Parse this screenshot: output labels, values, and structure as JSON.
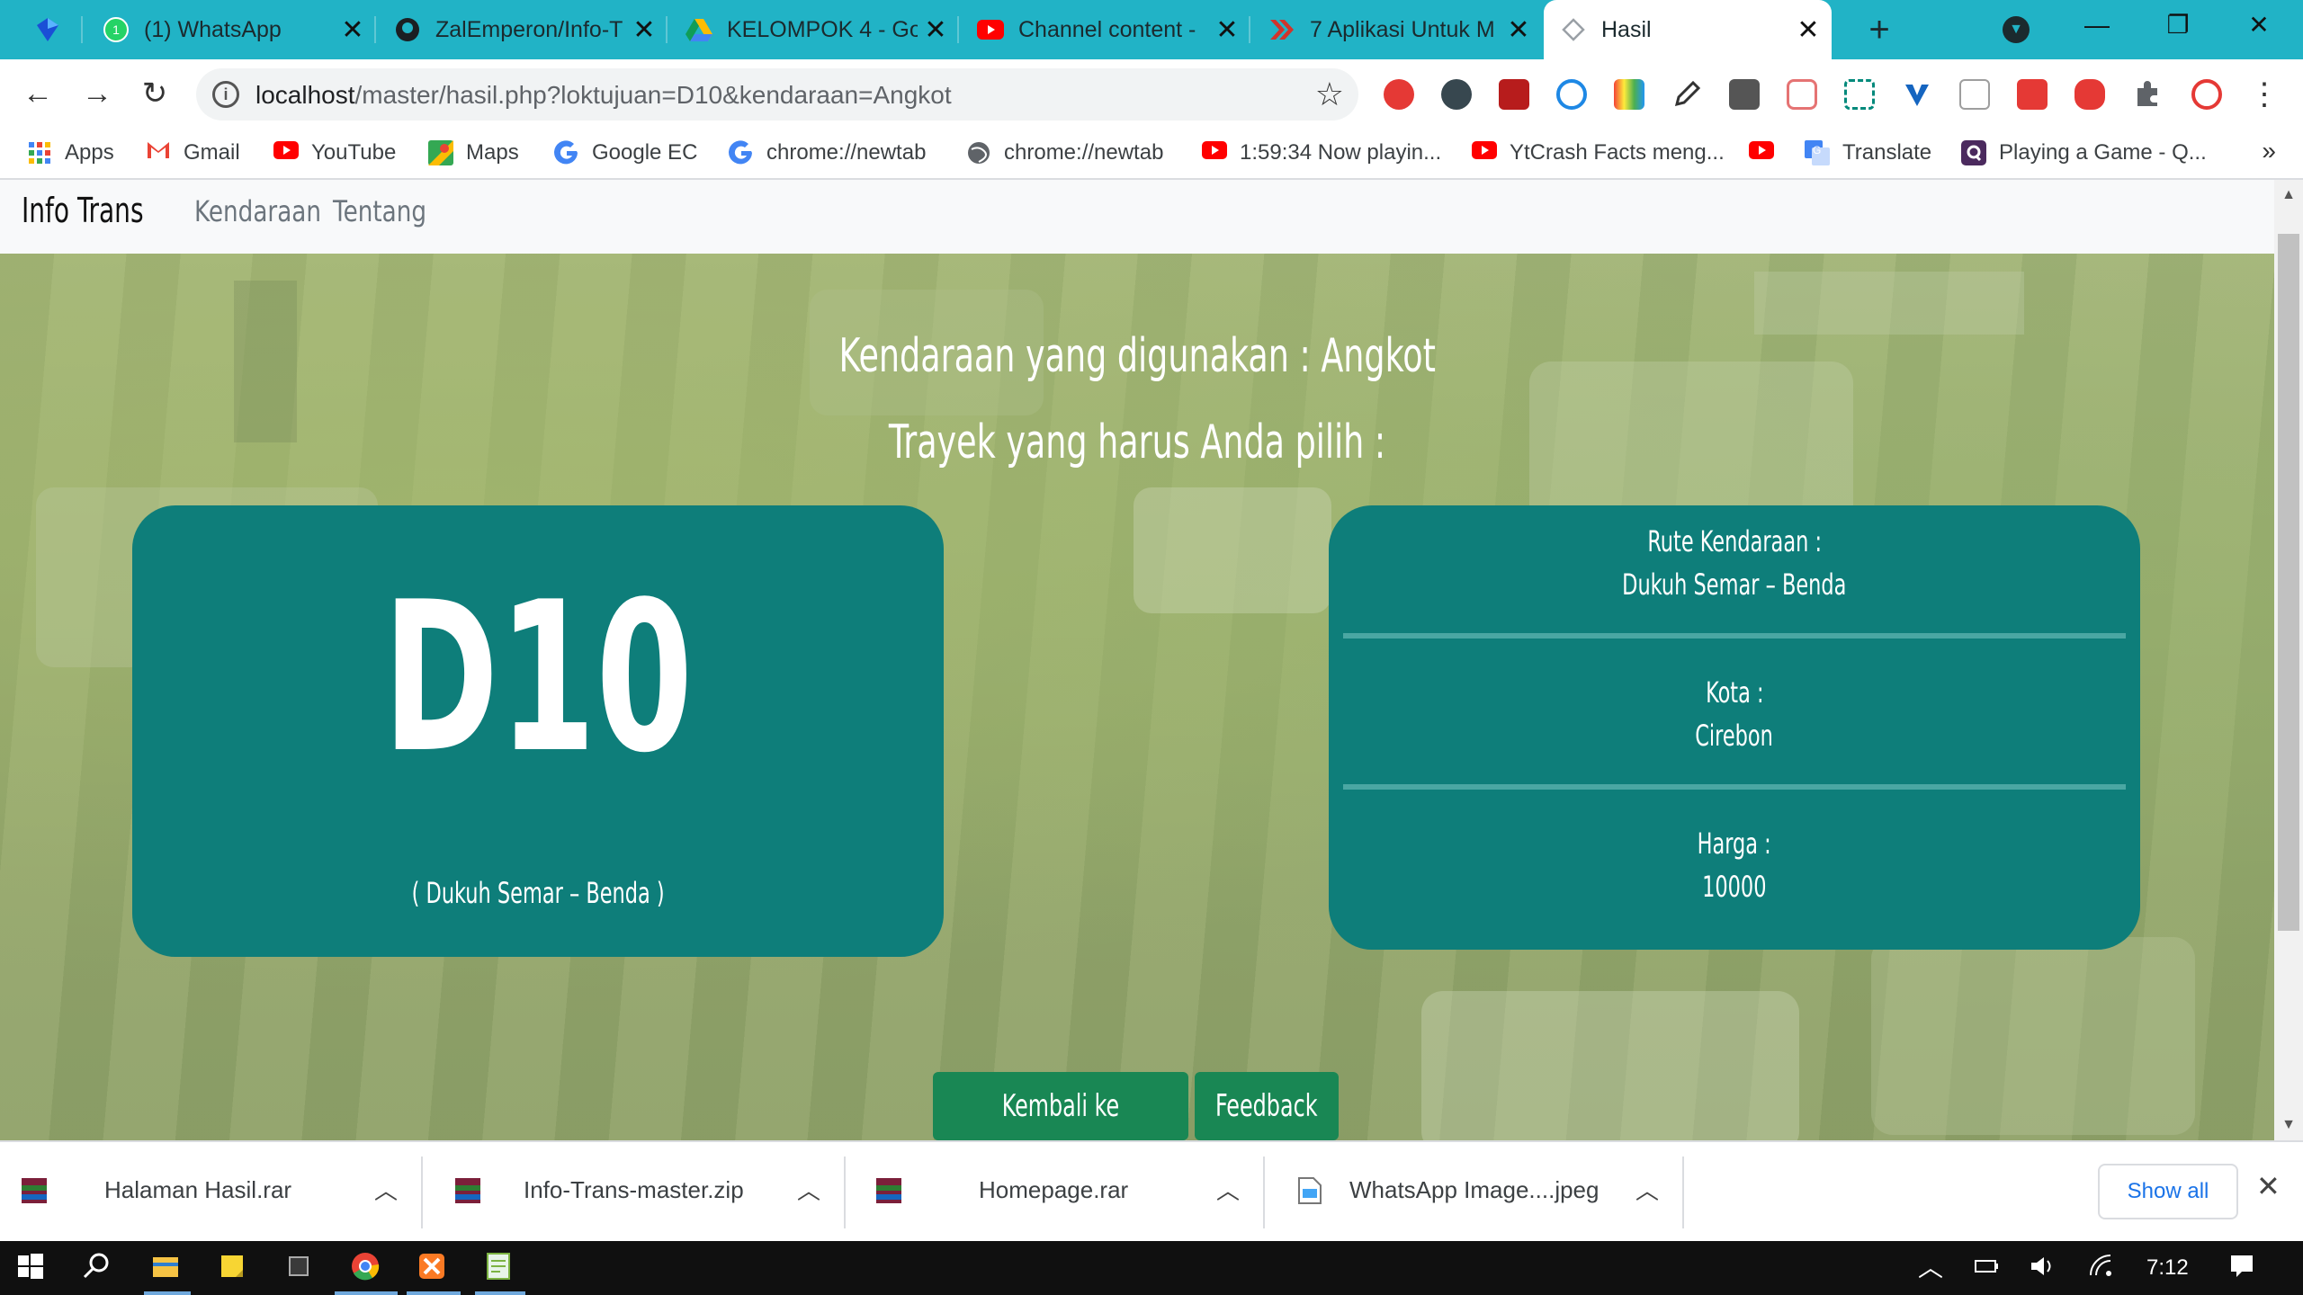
{
  "browser": {
    "tabs": [
      {
        "title": "",
        "icon": "maps-pin-icon"
      },
      {
        "title": "(1) WhatsApp",
        "icon": "whatsapp-icon"
      },
      {
        "title": "ZalEmperon/Info-T",
        "icon": "github-icon"
      },
      {
        "title": "KELOMPOK 4 - Go",
        "icon": "google-drive-icon"
      },
      {
        "title": "Channel content -",
        "icon": "youtube-icon"
      },
      {
        "title": "7 Aplikasi Untuk M",
        "icon": "red-arrows-icon"
      },
      {
        "title": "Hasil",
        "icon": "page-icon"
      }
    ],
    "new_tab_label": "+",
    "address": {
      "host": "localhost",
      "path": "/master/hasil.php?loktujuan=D10&kendaraan=Angkot"
    },
    "bookmarks": [
      {
        "label": "Apps",
        "icon": "apps-grid-icon",
        "color": "#4285f4"
      },
      {
        "label": "Gmail",
        "icon": "gmail-icon",
        "color": "#ea4335"
      },
      {
        "label": "YouTube",
        "icon": "youtube-icon",
        "color": "#ff0000"
      },
      {
        "label": "Maps",
        "icon": "maps-icon",
        "color": "#34a853"
      },
      {
        "label": "Google EC",
        "icon": "google-icon",
        "color": "#4285f4"
      },
      {
        "label": "chrome://newtab",
        "icon": "google-icon",
        "color": "#4285f4"
      },
      {
        "label": "chrome://newtab",
        "icon": "globe-icon",
        "color": "#5f6368"
      },
      {
        "label": "1:59:34 Now playin...",
        "icon": "youtube-icon",
        "color": "#ff0000"
      },
      {
        "label": "YtCrash Facts meng...",
        "icon": "youtube-icon",
        "color": "#ff0000"
      },
      {
        "label": "",
        "icon": "youtube-icon",
        "color": "#ff0000"
      },
      {
        "label": "Translate",
        "icon": "translate-icon",
        "color": "#4285f4"
      },
      {
        "label": "Playing a Game - Q...",
        "icon": "quora-icon",
        "color": "#4b2a5e"
      }
    ],
    "bookmarks_more": "»"
  },
  "site": {
    "brand": "Info Trans",
    "nav": [
      "Kendaraan",
      "Tentang"
    ],
    "vehicle_line": "Kendaraan yang digunakan : Angkot",
    "route_prompt": "Trayek yang harus Anda pilih :",
    "route_code": "D10",
    "route_small": "( Dukuh Semar – Benda )",
    "info": {
      "route_label": "Rute Kendaraan :",
      "route_value": "Dukuh Semar – Benda",
      "city_label": "Kota :",
      "city_value": "Cirebon",
      "price_label": "Harga :",
      "price_value": "10000"
    },
    "buttons": {
      "home": "Kembali ke Beranda",
      "feedback": "Feedback"
    },
    "colors": {
      "card": "#0e7e7a",
      "button": "#198754"
    }
  },
  "downloads": {
    "items": [
      {
        "name": "Halaman Hasil.rar",
        "icon": "winrar-icon"
      },
      {
        "name": "Info-Trans-master.zip",
        "icon": "winrar-icon"
      },
      {
        "name": "Homepage.rar",
        "icon": "winrar-icon"
      },
      {
        "name": "WhatsApp Image....jpeg",
        "icon": "image-file-icon"
      }
    ],
    "show_all": "Show all"
  },
  "taskbar": {
    "time": "7:12"
  }
}
